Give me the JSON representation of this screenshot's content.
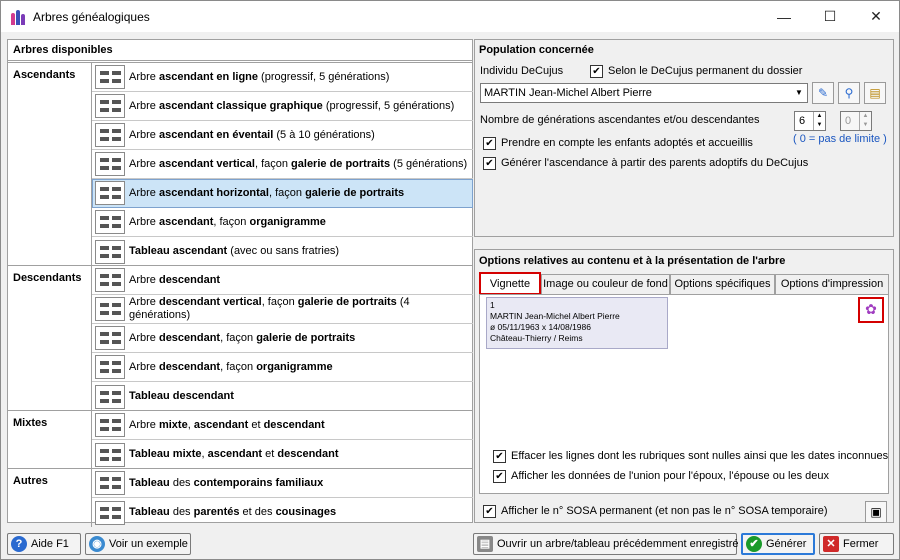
{
  "window": {
    "title": "Arbres généalogiques"
  },
  "left": {
    "header": "Arbres disponibles",
    "groups": [
      {
        "label": "Ascendants",
        "items": [
          {
            "pre": "Arbre ",
            "b1": "ascendant en ligne",
            "mid": " (progressif, 5 générations)",
            "b2": "",
            "post": ""
          },
          {
            "pre": "Arbre ",
            "b1": "ascendant classique graphique",
            "mid": " (progressif, 5 générations)",
            "b2": "",
            "post": ""
          },
          {
            "pre": "Arbre ",
            "b1": "ascendant en éventail",
            "mid": " (5 à 10 générations)",
            "b2": "",
            "post": ""
          },
          {
            "pre": "Arbre ",
            "b1": "ascendant vertical",
            "mid": ", façon ",
            "b2": "galerie de portraits",
            "post": " (5 générations)"
          },
          {
            "pre": "Arbre ",
            "b1": "ascendant horizontal",
            "mid": ", façon ",
            "b2": "galerie de portraits",
            "post": ""
          },
          {
            "pre": "Arbre ",
            "b1": "ascendant",
            "mid": ", façon ",
            "b2": "organigramme",
            "post": ""
          },
          {
            "pre": "",
            "b1": "Tableau ascendant",
            "mid": "  (avec ou sans fratries)",
            "b2": "",
            "post": ""
          }
        ]
      },
      {
        "label": "Descendants",
        "items": [
          {
            "pre": "Arbre ",
            "b1": "descendant",
            "mid": "",
            "b2": "",
            "post": ""
          },
          {
            "pre": "Arbre ",
            "b1": "descendant vertical",
            "mid": ", façon ",
            "b2": "galerie de portraits",
            "post": " (4 générations)"
          },
          {
            "pre": "Arbre ",
            "b1": "descendant",
            "mid": ", façon ",
            "b2": "galerie de portraits",
            "post": ""
          },
          {
            "pre": "Arbre ",
            "b1": "descendant",
            "mid": ", façon ",
            "b2": "organigramme",
            "post": ""
          },
          {
            "pre": "",
            "b1": "Tableau descendant",
            "mid": "",
            "b2": "",
            "post": ""
          }
        ]
      },
      {
        "label": "Mixtes",
        "items": [
          {
            "pre": "Arbre ",
            "b1": "mixte",
            "mid": ", ",
            "b2": "ascendant",
            "post": " et ",
            "b3": "descendant"
          },
          {
            "pre": "",
            "b1": "Tableau mixte",
            "mid": ", ",
            "b2": "ascendant",
            "post": " et ",
            "b3": "descendant"
          }
        ]
      },
      {
        "label": "Autres",
        "items": [
          {
            "pre": "",
            "b1": "Tableau",
            "mid": " des ",
            "b2": "contemporains familiaux",
            "post": ""
          },
          {
            "pre": "",
            "b1": "Tableau",
            "mid": " des ",
            "b2": "parentés",
            "post": " et des ",
            "b3": "cousinages"
          }
        ]
      }
    ]
  },
  "population": {
    "title": "Population concernée",
    "decujus_label": "Individu DeCujus",
    "permanent_label": "Selon le DeCujus permanent du dossier",
    "decujus_value": "MARTIN Jean-Michel Albert Pierre",
    "generations_label": "Nombre de générations ascendantes et/ou descendantes",
    "gen_asc": "6",
    "gen_desc": "0",
    "no_limit": "( 0 = pas de limite )",
    "adopted_label": "Prendre en compte les enfants adoptés et accueillis",
    "adoptive_label": "Générer l'ascendance à partir des parents adoptifs du DeCujus"
  },
  "options": {
    "title": "Options relatives au contenu et à la présentation de l'arbre",
    "tabs": [
      "Vignette",
      "Image ou couleur de fond",
      "Options spécifiques",
      "Options d'impression"
    ],
    "vignette": {
      "line1": "1",
      "line2": "MARTIN Jean-Michel Albert Pierre",
      "line3": "ø 05/11/1963  x 14/08/1986",
      "line4": "Château-Thierry / Reims"
    },
    "clear_lines_label": "Effacer les lignes dont les rubriques sont nulles ainsi que les dates inconnues",
    "union_label": "Afficher les données de l'union pour l'époux, l'épouse ou les deux"
  },
  "sosa_label": "Afficher le n° SOSA permanent (et non pas le n° SOSA temporaire)",
  "buttons": {
    "help": "Aide   F1",
    "example": "Voir un exemple",
    "open": "Ouvrir un arbre/tableau précédemment enregistré",
    "generate": "Générer",
    "close": "Fermer"
  }
}
